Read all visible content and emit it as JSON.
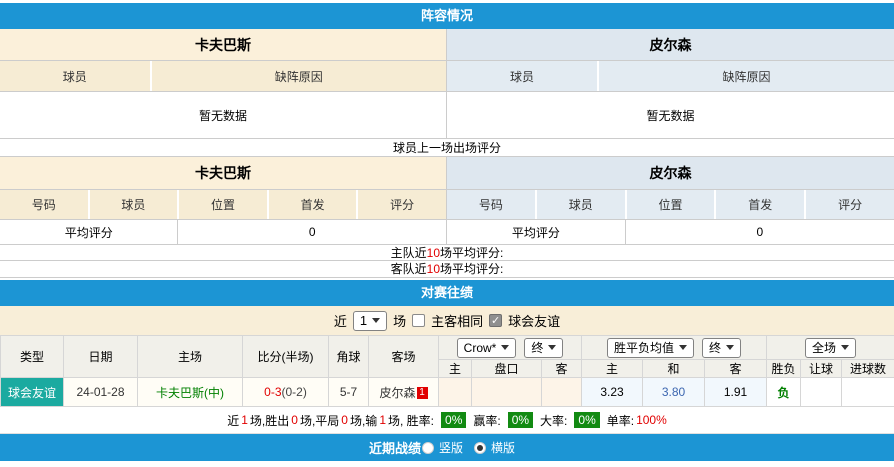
{
  "lineup": {
    "title": "阵容情况",
    "home_team": "卡夫巴斯",
    "away_team": "皮尔森",
    "col_player": "球员",
    "col_reason": "缺阵原因",
    "no_data": "暂无数据"
  },
  "ratings": {
    "note": "球员上一场出场评分",
    "home_team": "卡夫巴斯",
    "away_team": "皮尔森",
    "cols": [
      "号码",
      "球员",
      "位置",
      "首发",
      "评分"
    ],
    "avg_label": "平均评分",
    "home_avg": "0",
    "away_avg": "0",
    "home_line": {
      "pre": "主队近",
      "num": "10",
      "post": "场平均评分:"
    },
    "away_line": {
      "pre": "客队近",
      "num": "10",
      "post": "场平均评分:"
    }
  },
  "h2h": {
    "title": "对赛往绩",
    "filter": {
      "near": "近",
      "count": "1",
      "games": "场",
      "check_mark": "✓",
      "same_venue": "主客相同",
      "friendly": "球会友谊"
    },
    "headers": [
      "类型",
      "日期",
      "主场",
      "比分(半场)",
      "角球",
      "客场"
    ],
    "selects": {
      "company": "Crow*",
      "final1": "终",
      "avg": "胜平负均值",
      "final2": "终",
      "scope": "全场"
    },
    "sub_headers": [
      "主",
      "盘口",
      "客",
      "主",
      "和",
      "客",
      "胜负",
      "让球",
      "进球数"
    ],
    "row": {
      "type": "球会友谊",
      "date": "24-01-28",
      "home": "卡夫巴斯(中)",
      "score": "0-3",
      "half": "(0-2)",
      "corners": "5-7",
      "away": "皮尔森",
      "badge": "1",
      "odd_home": "3.23",
      "odd_draw": "3.80",
      "odd_away": "1.91",
      "result": "负"
    },
    "stats": {
      "s1": "近",
      "n1": "1",
      "s2": "场,胜出",
      "n2": "0",
      "s3": "场,平局",
      "n3": "0",
      "s4": "场,输",
      "n4": "1",
      "s5": "场, 胜率:",
      "b1": "0%",
      "s6": "赢率:",
      "b2": "0%",
      "s7": "大率:",
      "b3": "0%",
      "s8": "单率:",
      "n5": "100%"
    }
  },
  "footer": {
    "title": "近期战绩",
    "opt1": "竖版",
    "opt2": "横版"
  }
}
